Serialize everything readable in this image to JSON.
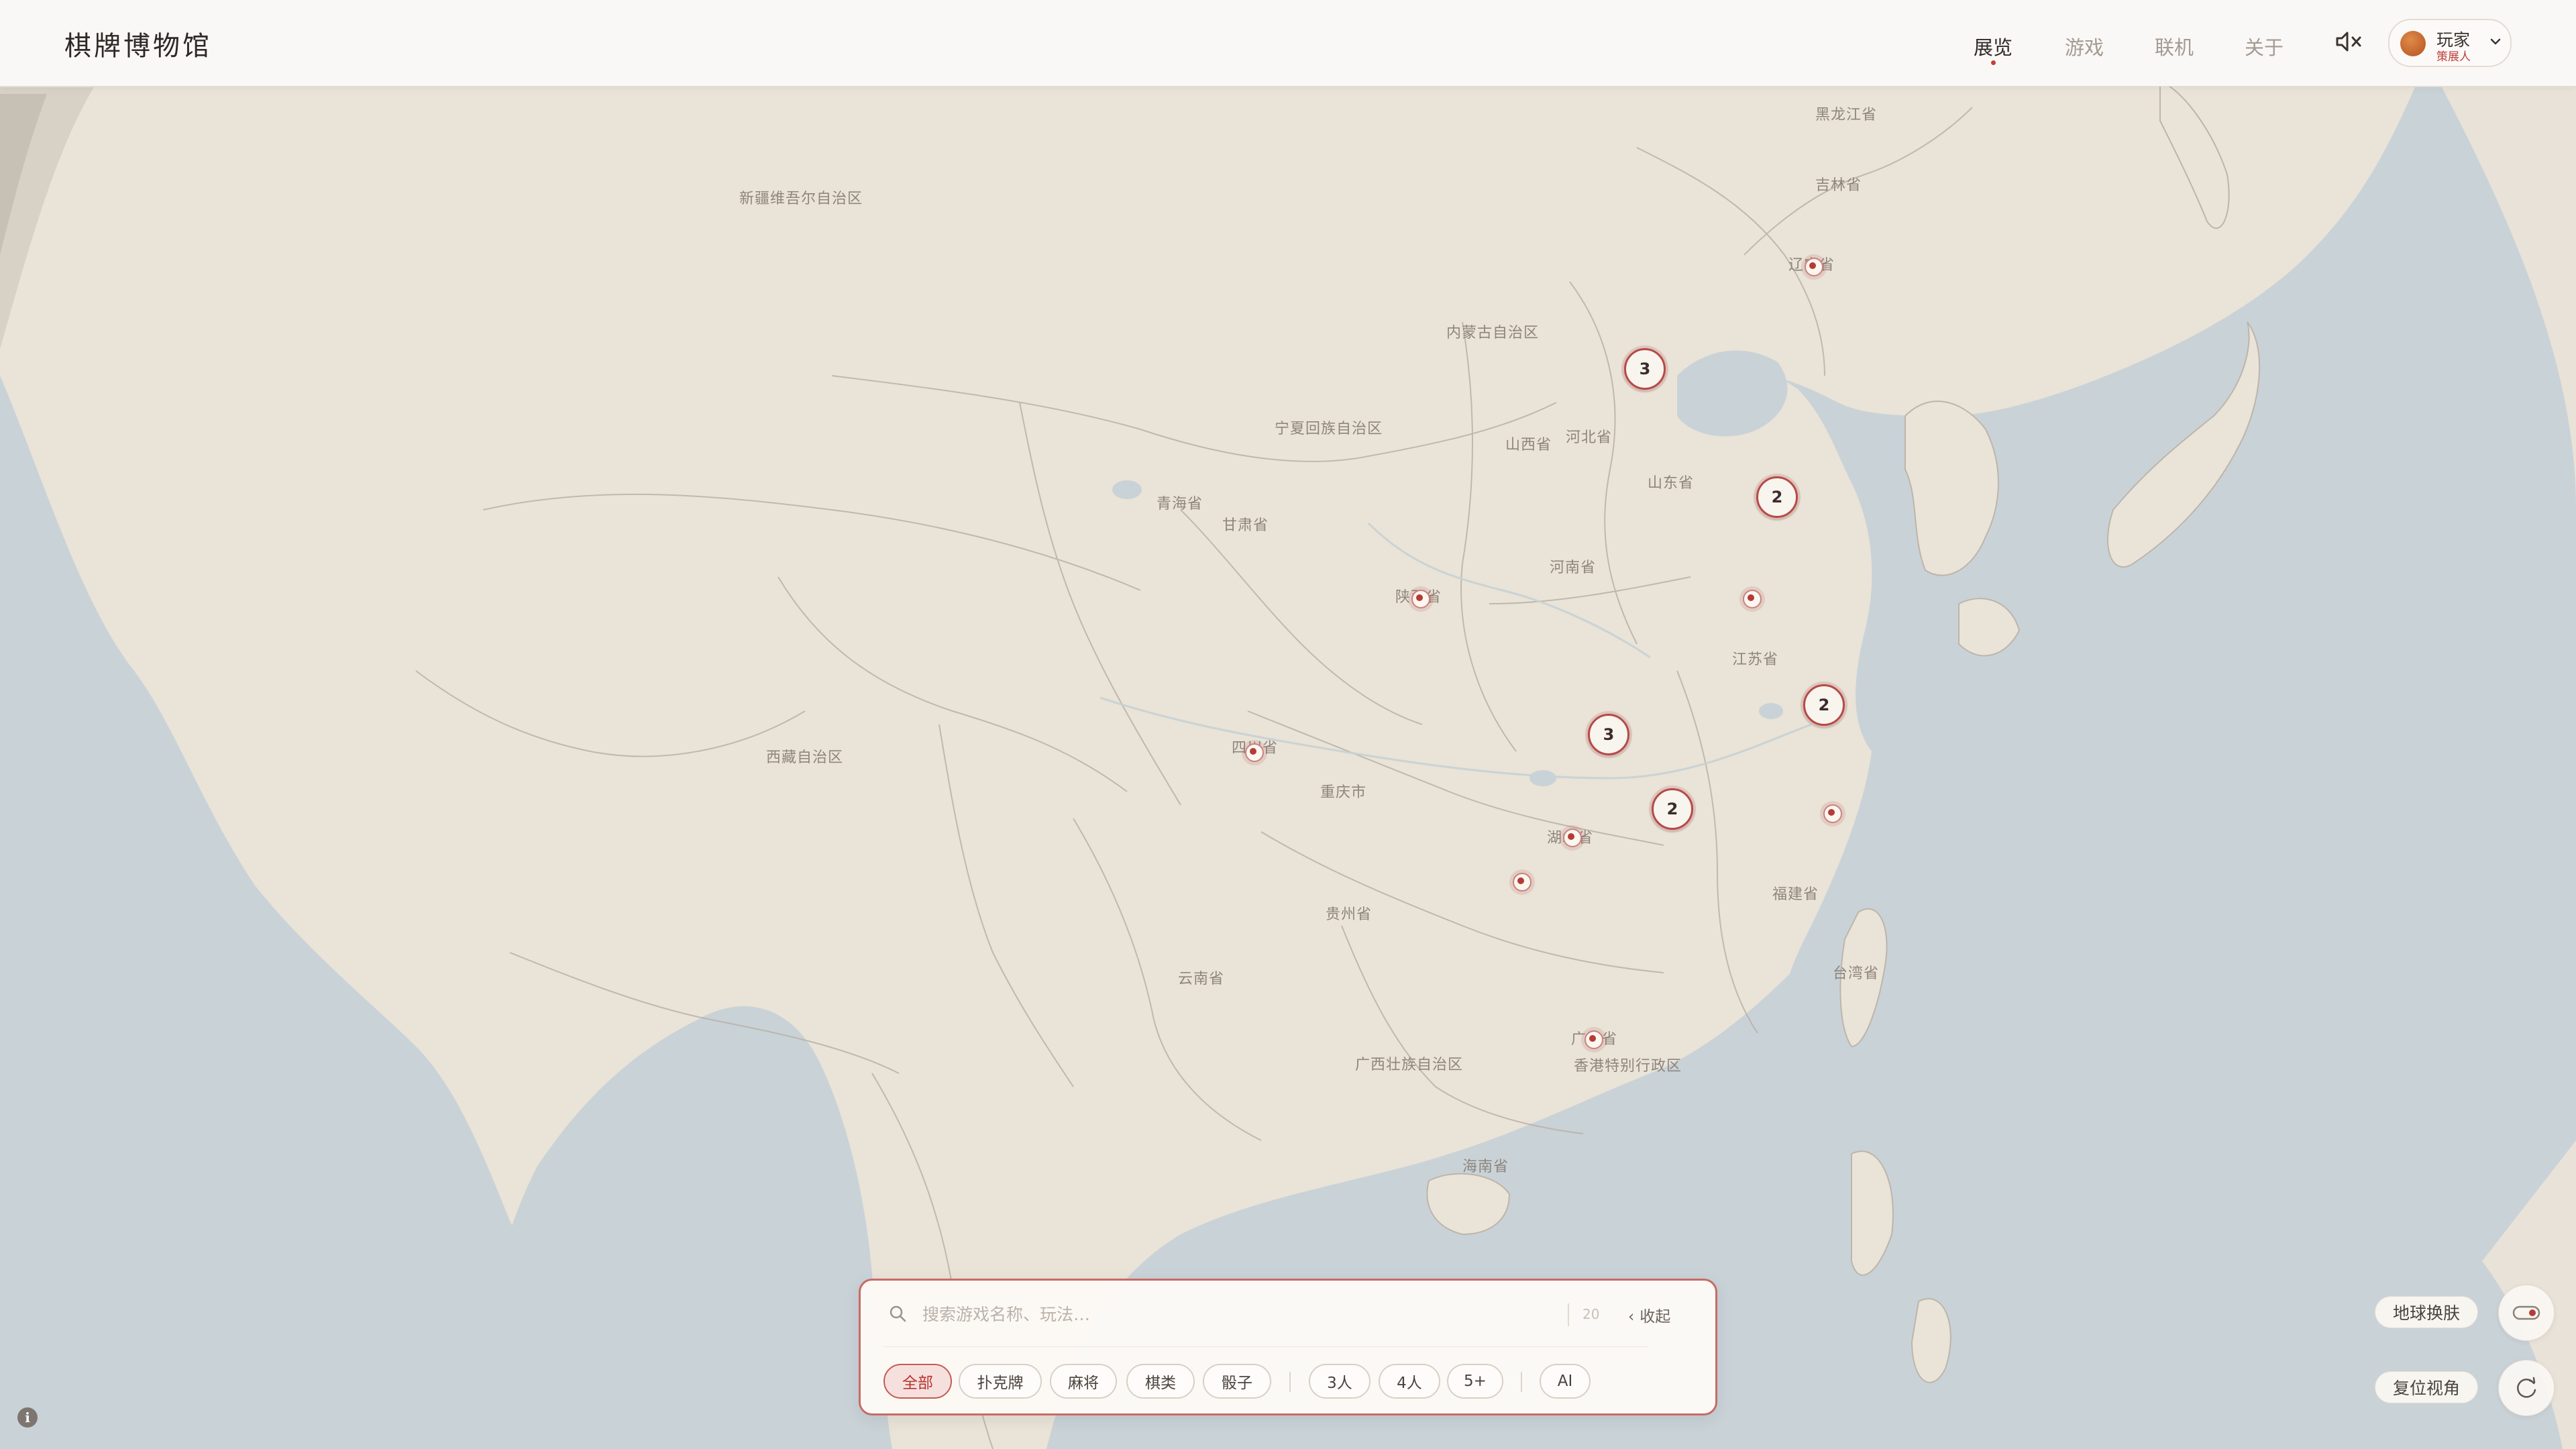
{
  "app": {
    "title": "棋牌博物馆"
  },
  "nav": {
    "items": [
      {
        "label": "展览",
        "active": true
      },
      {
        "label": "游戏",
        "active": false
      },
      {
        "label": "联机",
        "active": false
      },
      {
        "label": "关于",
        "active": false
      }
    ],
    "mute_icon": "speaker-muted-icon"
  },
  "user": {
    "name": "玩家",
    "status": "策展人",
    "avatar_color": "#c8692d"
  },
  "map": {
    "region_labels": [
      "黑龙江省",
      "吉林省",
      "辽宁省",
      "新疆维吾尔自治区",
      "内蒙古自治区",
      "宁夏回族自治区",
      "山西省",
      "河北省",
      "山东省",
      "青海省",
      "甘肃省",
      "陕西省",
      "河南省",
      "江苏省",
      "西藏自治区",
      "四川省",
      "重庆市",
      "湖北省",
      "贵州省",
      "福建省",
      "台湾省",
      "云南省",
      "广东省",
      "广西壮族自治区",
      "香港特别行政区",
      "海南省"
    ],
    "clusters": [
      {
        "count": "3"
      },
      {
        "count": "2"
      },
      {
        "count": "2"
      },
      {
        "count": "3"
      },
      {
        "count": "2"
      }
    ],
    "pin_count": 9,
    "colors": {
      "ocean": "#c9d3d8",
      "land": "#eae4da",
      "border": "#b9b1a7",
      "marker": "#b63a36"
    }
  },
  "search": {
    "placeholder": "搜索游戏名称、玩法…",
    "result_count": "20",
    "collapse_label": "收起",
    "filters": {
      "category": [
        {
          "label": "全部",
          "active": true
        },
        {
          "label": "扑克牌",
          "active": false
        },
        {
          "label": "麻将",
          "active": false
        },
        {
          "label": "棋类",
          "active": false
        },
        {
          "label": "骰子",
          "active": false
        }
      ],
      "players": [
        {
          "label": "3人"
        },
        {
          "label": "4人"
        },
        {
          "label": "5+"
        }
      ],
      "ai": {
        "label": "AI"
      }
    }
  },
  "controls": {
    "skin_label": "地球换肤",
    "reset_label": "复位视角"
  }
}
